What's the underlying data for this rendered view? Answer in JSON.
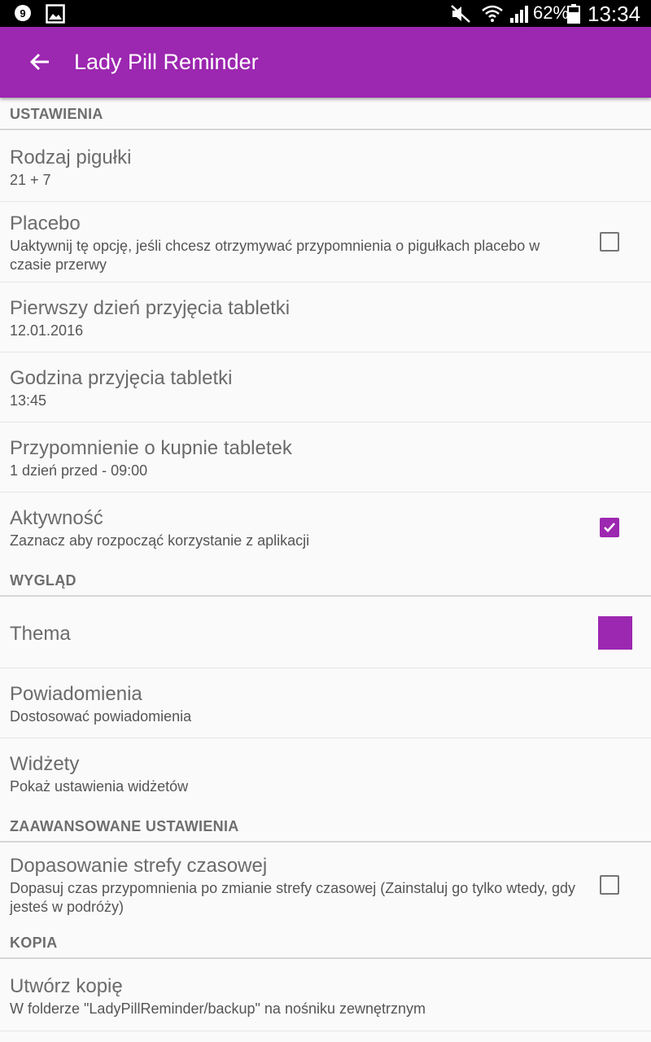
{
  "status_bar": {
    "battery_percent": "62%",
    "time": "13:34",
    "icons": [
      "chat-notification-icon",
      "gallery-notification-icon",
      "mute-icon",
      "wifi-icon",
      "signal-icon",
      "battery-icon"
    ]
  },
  "app_bar": {
    "title": "Lady Pill Reminder",
    "back_icon": "arrow-back-icon",
    "color": "#9c27b0"
  },
  "sections": {
    "settings": "USTAWIENIA",
    "appearance": "WYGLĄD",
    "advanced": "ZAAWANSOWANE USTAWIENIA",
    "backup": "KOPIA"
  },
  "items": {
    "pill_type": {
      "title": "Rodzaj pigułki",
      "summary": "21 + 7"
    },
    "placebo": {
      "title": "Placebo",
      "summary": "Uaktywnij tę opcję, jeśli chcesz otrzymywać przypomnienia o pigułkach placebo w czasie przerwy",
      "checked": false
    },
    "first_day": {
      "title": "Pierwszy dzień przyjęcia tabletki",
      "summary": "12.01.2016"
    },
    "pill_time": {
      "title": "Godzina przyjęcia tabletki",
      "summary": "13:45"
    },
    "buy_reminder": {
      "title": "Przypomnienie o kupnie tabletek",
      "summary": "1 dzień przed - 09:00"
    },
    "activity": {
      "title": "Aktywność",
      "summary": "Zaznacz aby rozpocząć korzystanie z aplikacji",
      "checked": true
    },
    "theme": {
      "title": "Thema",
      "color": "#9c27b0"
    },
    "notifications": {
      "title": "Powiadomienia",
      "summary": "Dostosować powiadomienia"
    },
    "widgets": {
      "title": "Widżety",
      "summary": "Pokaż ustawienia widżetów"
    },
    "timezone": {
      "title": "Dopasowanie strefy czasowej",
      "summary": "Dopasuj czas przypomnienia po zmianie strefy czasowej (Zainstaluj go tylko wtedy, gdy jesteś w podróży)",
      "checked": false
    },
    "create_backup": {
      "title": "Utwórz kopię",
      "summary": "W folderze \"LadyPillReminder/backup\" na nośniku zewnętrznym"
    }
  }
}
